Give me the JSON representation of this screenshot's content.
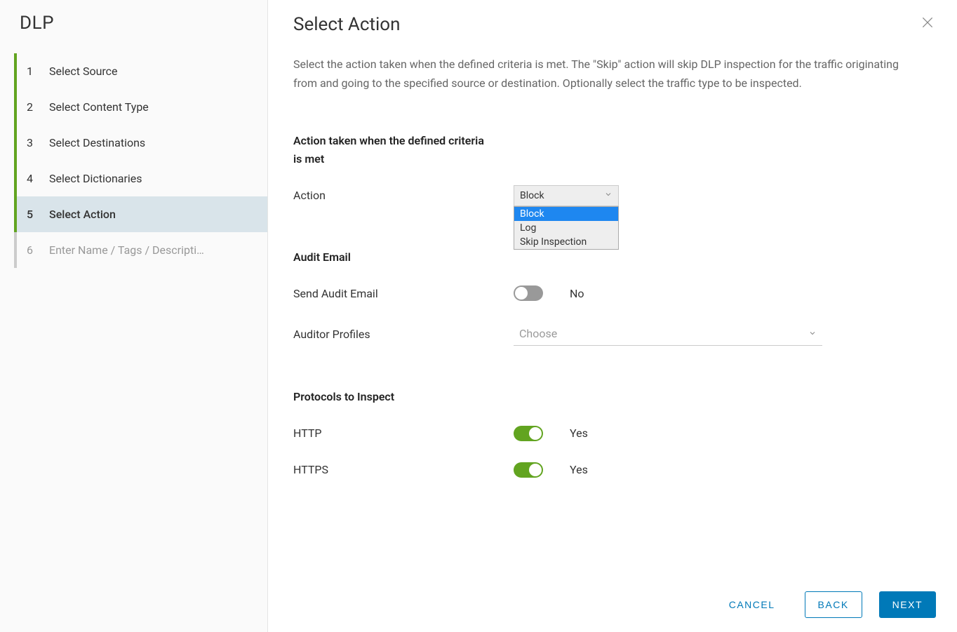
{
  "sidebar": {
    "title": "DLP",
    "steps": [
      {
        "num": "1",
        "label": "Select Source",
        "state": "completed"
      },
      {
        "num": "2",
        "label": "Select Content Type",
        "state": "completed"
      },
      {
        "num": "3",
        "label": "Select Destinations",
        "state": "completed"
      },
      {
        "num": "4",
        "label": "Select Dictionaries",
        "state": "completed"
      },
      {
        "num": "5",
        "label": "Select Action",
        "state": "active"
      },
      {
        "num": "6",
        "label": "Enter Name / Tags / Descripti…",
        "state": "upcoming"
      }
    ]
  },
  "main": {
    "title": "Select Action",
    "description": "Select the action taken when the defined criteria is met. The \"Skip\" action will skip DLP inspection for the traffic originating from and going to the specified source or destination. Optionally select the traffic type to be inspected.",
    "action_section_header": "Action taken when the defined criteria is met",
    "action_label": "Action",
    "action_selected": "Block",
    "action_options": [
      "Block",
      "Log",
      "Skip Inspection"
    ],
    "audit_header": "Audit Email",
    "audit_send_label": "Send Audit Email",
    "audit_send_value": "No",
    "auditor_profiles_label": "Auditor Profiles",
    "auditor_profiles_placeholder": "Choose",
    "protocols_header": "Protocols to Inspect",
    "http_label": "HTTP",
    "http_value": "Yes",
    "https_label": "HTTPS",
    "https_value": "Yes"
  },
  "footer": {
    "cancel": "CANCEL",
    "back": "BACK",
    "next": "NEXT"
  }
}
